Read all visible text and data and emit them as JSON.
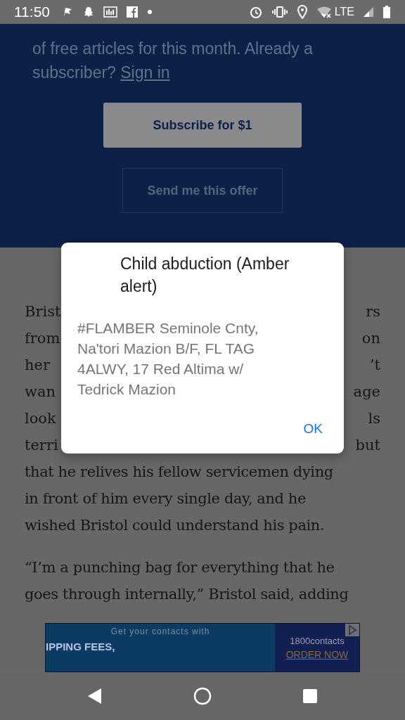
{
  "status_bar": {
    "time": "11:50",
    "network": "LTE"
  },
  "paywall": {
    "lines": [
      {
        "text": "of free articles for this month. Already a"
      }
    ],
    "last_line": "subscriber? ",
    "link": "Sign in",
    "subscribe_button": "Subscribe for $1",
    "offer_button": "Send me this offer"
  },
  "article": {
    "partial_lines": [
      {
        "left": "Brist",
        "right": "rs"
      },
      {
        "left": "from",
        "right": "on"
      },
      {
        "left": "her",
        "right": "’t"
      },
      {
        "left": "wan",
        "right": "age"
      },
      {
        "left": "look",
        "right": "ls"
      },
      {
        "left": "terri",
        "right": "but"
      }
    ],
    "paragraphs": [
      [
        "that he relives his fellow servicemen dying",
        "in front of him every single day, and he",
        "wished Bristol could understand his pain."
      ],
      [
        "“I’m a punching bag for everything that he",
        "goes through internally,” Bristol said, adding"
      ]
    ]
  },
  "dialog": {
    "title": "Child abduction (Amber alert)",
    "message": "#FLAMBER Seminole Cnty, Na'tori Mazion B/F, FL TAG 4ALWY, 17 Red Altima w/ Tedrick Mazion",
    "button": "OK"
  },
  "ad": {
    "headline": "Get your contacts with",
    "tagline": "IPPING FEES,",
    "brand": "1800contacts",
    "cta": "ORDER NOW"
  }
}
